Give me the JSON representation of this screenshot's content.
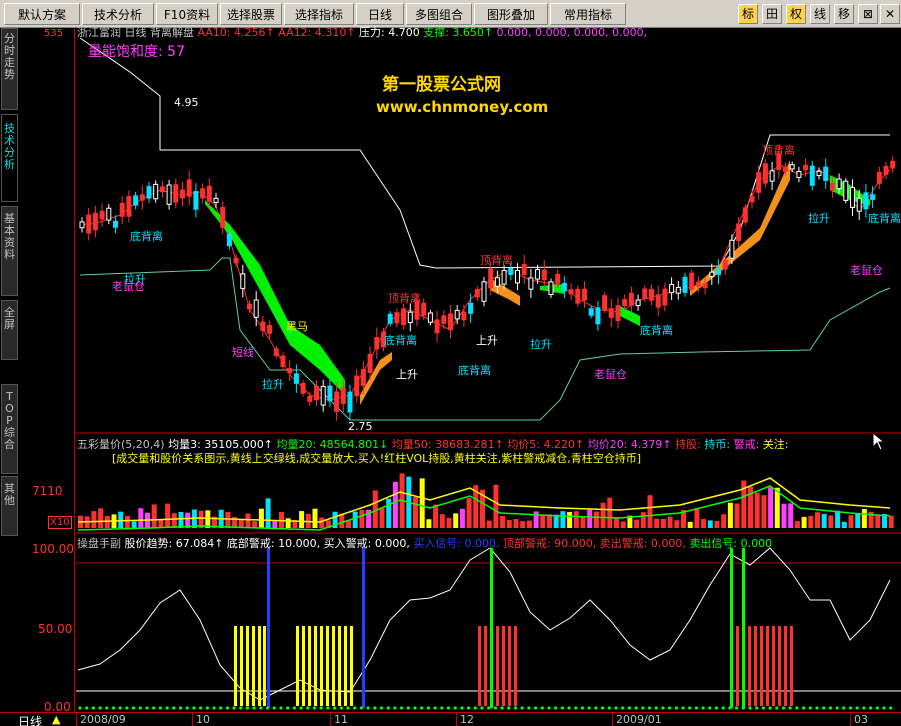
{
  "menu": {
    "items": [
      "默认方案",
      "技术分析",
      "F10资料",
      "选择股票",
      "选择指标",
      "日线",
      "多图组合",
      "图形叠加",
      "常用指标"
    ],
    "tools": [
      "标",
      "田",
      "权",
      "线",
      "移",
      "⊠",
      "✕"
    ]
  },
  "sidebar": {
    "tabs": [
      "分时走势",
      "技术分析",
      "基本资料",
      "全屏",
      "TOP综合",
      "其他"
    ]
  },
  "price_panel": {
    "stock_name": "浙江富润",
    "period": "日线",
    "indicator": "背离解盘",
    "aa10_label": "AA10: 4.256↑",
    "aa12_label": "AA12: 4.310↑",
    "pressure_label": "压力: 4.700",
    "support_label": "支撑: 3.650↑",
    "zeros": "0.000, 0.000, 0.000, 0.000,",
    "saturation": "量能饱和度: 57",
    "watermark_title": "第一股票公式网",
    "watermark_url": "www.chnmoney.com",
    "top_value": "4.95",
    "low_value": "2.75",
    "annotations": {
      "la_sheng": "拉升",
      "lao_shu_cang": "老鼠仓",
      "di_bei_li": "底背离",
      "ding_bei_li": "顶背离",
      "duan_xian": "短线",
      "hei_ma": "黑马",
      "shang_sheng": "上升",
      "left_peek": "535"
    }
  },
  "volume_panel": {
    "header": "五彩量价(5,20,4)",
    "ma3": "均量3: 35105.000↑",
    "ma20": "均量20: 48564.801↓",
    "ma50": "均量50: 38683.281↑",
    "ma5p": "均价5: 4.220↑",
    "ma20p": "均价20: 4.379↑",
    "hold": "持股:",
    "holdcoin": "持币:",
    "alert": "警戒:",
    "focus": "关注:",
    "note": "[成交量和股价关系图示,黄线上交绿线,成交量放大,买入!红柱VOL持股,黄柱关注,紫柱警戒减仓,青柱空仓持币]",
    "axis_value": "7110",
    "axis_unit": "X10"
  },
  "osc_panel": {
    "header": "操盘手副",
    "trend": "股价趋势: 67.084↑",
    "bottom": "底部警戒: 10.000,",
    "buy_alert": "买入警戒: 0.000,",
    "buy_signal": "买入信号: 0.000,",
    "top_alert": "顶部警戒: 90.000,",
    "sell_alert": "卖出警戒: 0.000,",
    "sell_signal": "卖出信号: 0.000",
    "ticks": [
      "100.00",
      "50.00",
      "0.00"
    ]
  },
  "bottom_bar": {
    "period": "日线",
    "dates": [
      "2008/09",
      "10",
      "11",
      "12",
      "2009/01",
      "03"
    ]
  },
  "colors": {
    "red": "#ff3030",
    "yellow": "#ffff00",
    "green": "#00ff00",
    "orange": "#ff9a1e",
    "cyan": "#00e0ff",
    "magenta": "#ff40ff",
    "white": "#ffffff",
    "blue": "#2040ff"
  }
}
